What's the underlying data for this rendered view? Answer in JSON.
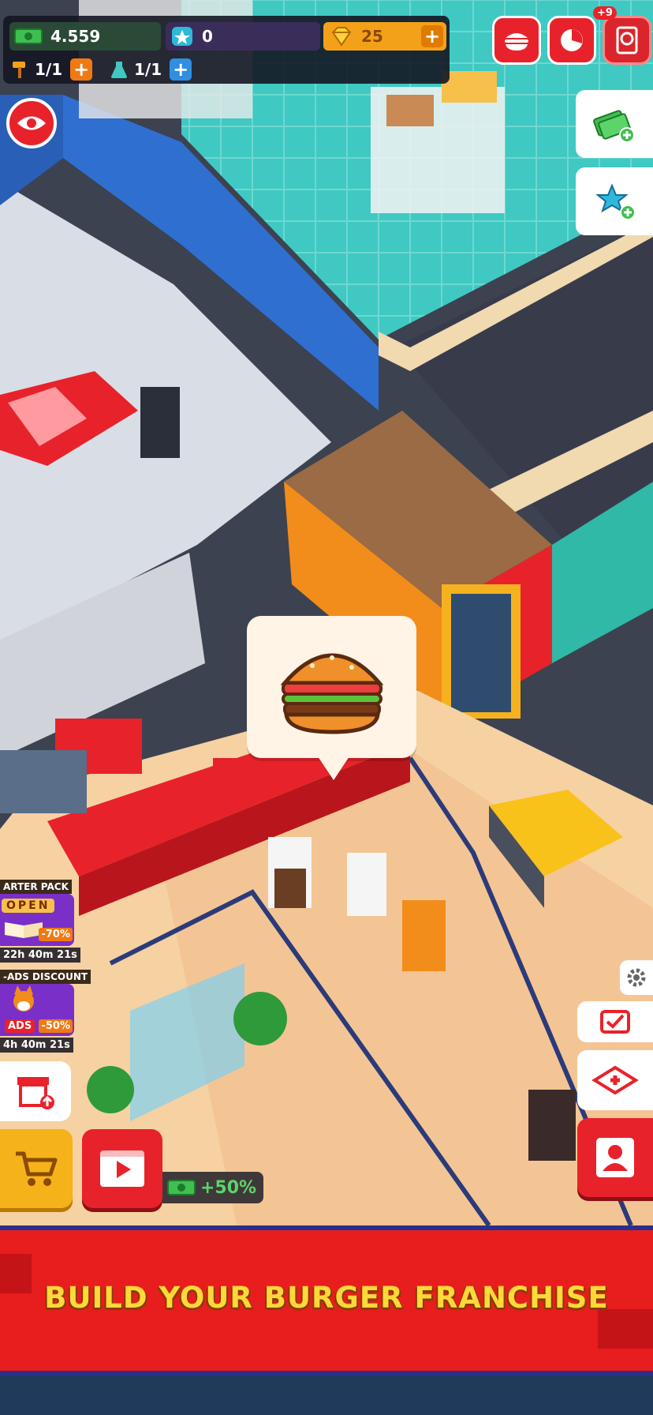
{
  "hud": {
    "cash": "4.559",
    "stars": "0",
    "gems": "25",
    "hammer_count": "1/1",
    "flask_count": "1/1",
    "plus_symbol": "+",
    "notification_badge": "+9"
  },
  "promos": {
    "starter_pack": {
      "label": "ARTER PACK",
      "sign_text": "OPEN",
      "discount": "-70%",
      "timer": "22h 40m 21s"
    },
    "ads_discount": {
      "label": "-ADS DISCOUNT",
      "badge": "ADS",
      "discount": "-50%",
      "timer": "4h 40m 21s"
    }
  },
  "boost": {
    "label": "+50%"
  },
  "banner": {
    "text": "BUILD YOUR BURGER FRANCHISE"
  },
  "colors": {
    "hud_bg": "#1e2233",
    "cash_green": "#3fbf4f",
    "gem_orange": "#f4a11a",
    "action_red": "#e8222a",
    "shop_yellow": "#f6b21a",
    "banner_red": "#e81d1d",
    "banner_text": "#ffd83a"
  }
}
